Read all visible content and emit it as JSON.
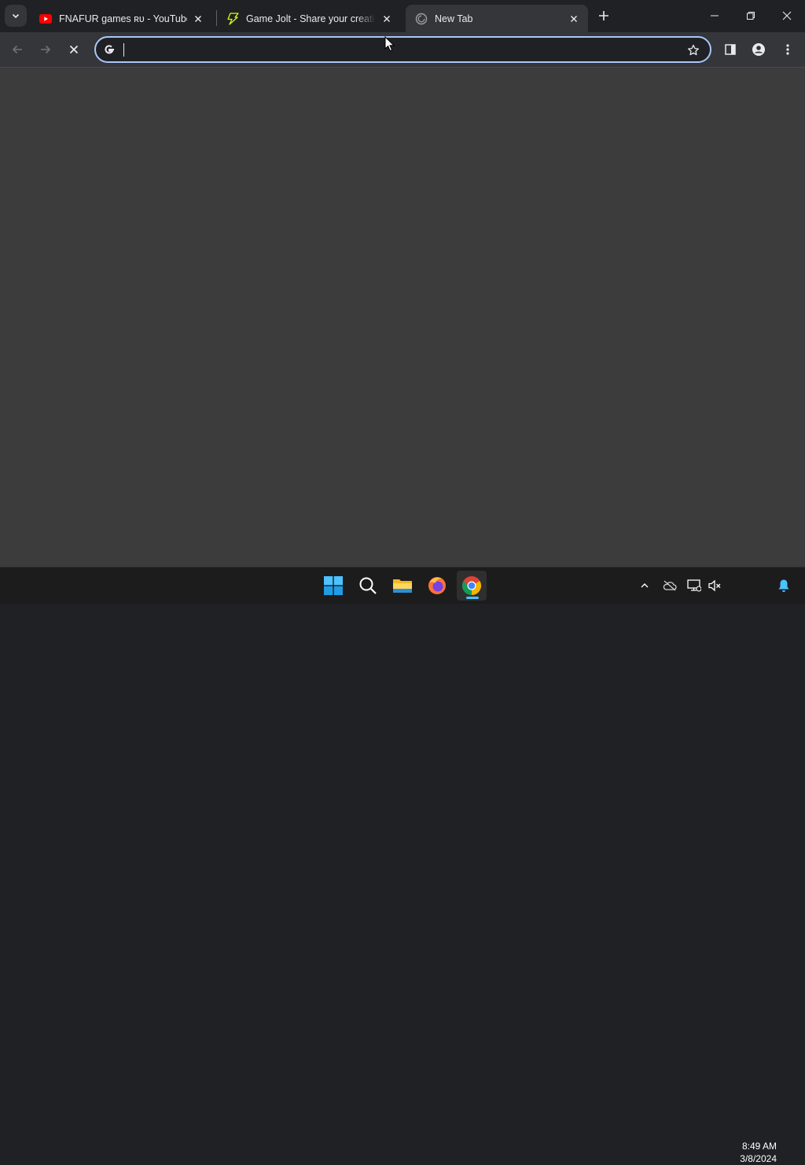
{
  "browser": {
    "tabs": [
      {
        "title": "FNAFUR games ʀᴜ - YouTube",
        "favicon": "youtube-icon",
        "active": false
      },
      {
        "title": "Game Jolt - Share your creations",
        "favicon": "gamejolt-icon",
        "active": false
      },
      {
        "title": "New Tab",
        "favicon": "chrome-newtab-icon",
        "active": true
      }
    ],
    "omnibox": {
      "value": "",
      "placeholder": ""
    },
    "page_state": "loading"
  },
  "taskbar": {
    "apps": [
      {
        "name": "Start",
        "icon": "windows-start-icon"
      },
      {
        "name": "Search",
        "icon": "search-icon"
      },
      {
        "name": "File Explorer",
        "icon": "file-explorer-icon"
      },
      {
        "name": "Firefox",
        "icon": "firefox-icon"
      },
      {
        "name": "Google Chrome",
        "icon": "chrome-icon",
        "active": true
      }
    ],
    "clock": {
      "time": "8:49 AM",
      "date": "3/8/2024"
    }
  },
  "colors": {
    "accent": "#a8c7fa",
    "taskbar_active": "#4cc2ff"
  }
}
